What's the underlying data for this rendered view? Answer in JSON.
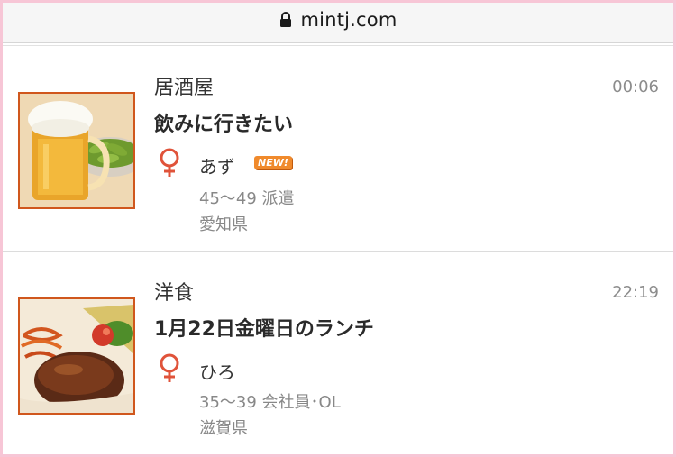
{
  "browser": {
    "url": "mintj.com",
    "lock_icon": "lock-icon"
  },
  "posts": [
    {
      "category": "居酒屋",
      "time": "00:06",
      "title": "飲みに行きたい",
      "gender_icon": "female-icon",
      "name": "あず",
      "badge": "NEW!",
      "age_job": "45〜49 派遣",
      "location": "愛知県",
      "image": "beer-edamame-image"
    },
    {
      "category": "洋食",
      "time": "22:19",
      "title": "1月22日金曜日のランチ",
      "gender_icon": "female-icon",
      "name": "ひろ",
      "age_job": "35〜39 会社員･OL",
      "location": "滋賀県",
      "image": "hamburg-steak-image"
    }
  ],
  "colors": {
    "frame": "#f7c6d6",
    "accent": "#e0533a",
    "badge": "#f08a2c",
    "thumb_border": "#d0571d"
  }
}
